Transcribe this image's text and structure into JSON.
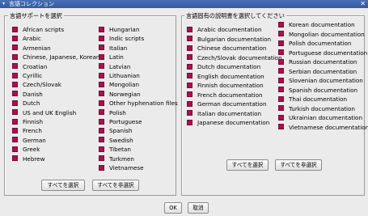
{
  "window": {
    "title": "言語コレクション",
    "close": "✕",
    "menu": "▾"
  },
  "support": {
    "title": "言語サポートを選択",
    "col1": [
      "African scripts",
      "Arabic",
      "Armenian",
      "Chinese, Japanese, Korean",
      "Croatian",
      "Cyrillic",
      "Czech/Slovak",
      "Danish",
      "Dutch",
      "US and UK English",
      "Finnish",
      "French",
      "German",
      "Greek",
      "Hebrew"
    ],
    "col2": [
      "Hungarian",
      "Indic scripts",
      "Italian",
      "Latin",
      "Latvian",
      "Lithuanian",
      "Mongolian",
      "Norwegian",
      "Other hyphenation files",
      "Polish",
      "Portuguese",
      "Spanish",
      "Swedish",
      "Tibetan",
      "Turkmen",
      "Vietnamese"
    ],
    "select_all": "すべてを選択",
    "deselect_all": "すべてを非選択"
  },
  "docs": {
    "title": "言語固有の説明書を選択してください",
    "col1": [
      "Arabic documentation",
      "Bulgarian documentation",
      "Chinese documentation",
      "Czech/Slovak documentation",
      "Dutch documentation",
      "English documentation",
      "Finnish documentation",
      "French documentation",
      "German documentation",
      "Italian documentation",
      "Japanese documentation"
    ],
    "col2": [
      "Korean documentation",
      "Mongolian documentation",
      "Polish documentation",
      "Portuguese documentation",
      "Russian documentation",
      "Serbian documentation",
      "Slovenian documentation",
      "Spanish documentation",
      "Thai documentation",
      "Turkish documentation",
      "Ukrainian documentation",
      "Vietnamese documentation"
    ],
    "select_all": "すべてを選択",
    "deselect_all": "すべてを非選択"
  },
  "buttons": {
    "ok": "OK",
    "cancel": "取消"
  },
  "colors": {
    "checkbox": "#a8124e",
    "titlebar": "#3f64ab"
  }
}
